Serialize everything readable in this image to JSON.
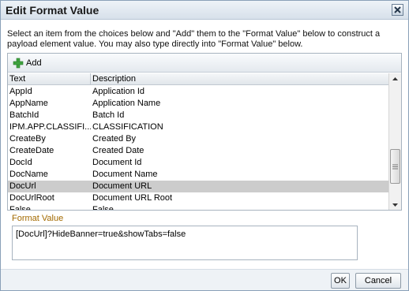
{
  "dialog": {
    "title": "Edit Format Value",
    "close_icon": "close-icon"
  },
  "instructions": "Select an item from the choices below and \"Add\" them to the \"Format Value\" below to construct a payload element value. You may also type directly into \"Format Value\" below.",
  "toolbar": {
    "add_label": "Add",
    "add_icon": "plus-icon"
  },
  "table": {
    "columns": [
      "Text",
      "Description"
    ],
    "rows": [
      {
        "text": "AppId",
        "description": "Application Id"
      },
      {
        "text": "AppName",
        "description": "Application Name"
      },
      {
        "text": "BatchId",
        "description": "Batch Id"
      },
      {
        "text": "IPM.APP.CLASSIFI...",
        "description": "CLASSIFICATION"
      },
      {
        "text": "CreateBy",
        "description": "Created By"
      },
      {
        "text": "CreateDate",
        "description": "Created Date"
      },
      {
        "text": "DocId",
        "description": "Document Id"
      },
      {
        "text": "DocName",
        "description": "Document Name"
      },
      {
        "text": "DocUrl",
        "description": "Document URL",
        "selected": true
      },
      {
        "text": "DocUrlRoot",
        "description": "Document URL Root"
      },
      {
        "text": "False",
        "description": "False"
      }
    ]
  },
  "format_value": {
    "label": "Format Value",
    "value": "[DocUrl]?HideBanner=true&showTabs=false"
  },
  "buttons": {
    "ok": "OK",
    "cancel": "Cancel"
  }
}
